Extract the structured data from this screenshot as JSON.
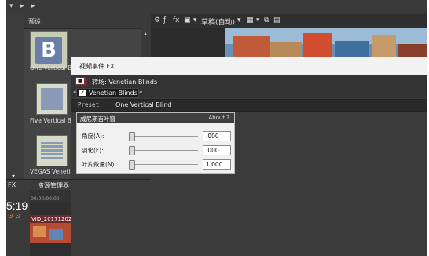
{
  "topbar": {
    "icons": [
      "down-arrow",
      "menu-arrow"
    ]
  },
  "presets": {
    "title": "预设:",
    "items": [
      {
        "label": "One Vertical Blind",
        "letter": "B"
      },
      {
        "label": "Five Vertical Bl",
        "letter": ""
      },
      {
        "label": "VEGAS Venetian",
        "letter": ""
      }
    ]
  },
  "right_toolbar": {
    "draft_label": "草稿(自动)"
  },
  "dialog": {
    "title": "视频事件 FX",
    "chain_text": "转场: Venetian Blinds",
    "plugin": "Venetian Blinds",
    "preset_label": "Preset:",
    "preset_value": "One Vertical Blind",
    "params": {
      "header": "威尼斯百叶窗",
      "about": "About ?",
      "fields": [
        {
          "label": "角度(A):",
          "value": ".000",
          "level": 0.0
        },
        {
          "label": "羽化(F):",
          "value": ".000",
          "level": 0.0
        },
        {
          "label": "叶片数量(N):",
          "value": "1.000",
          "level": 0.0
        }
      ]
    }
  },
  "bottom": {
    "tab_fx": "FX",
    "tab_explorer": "资源管理器",
    "timecode": "5:19",
    "ruler_tc": "00:00:00:00",
    "clip_name": "VID_20171202"
  }
}
